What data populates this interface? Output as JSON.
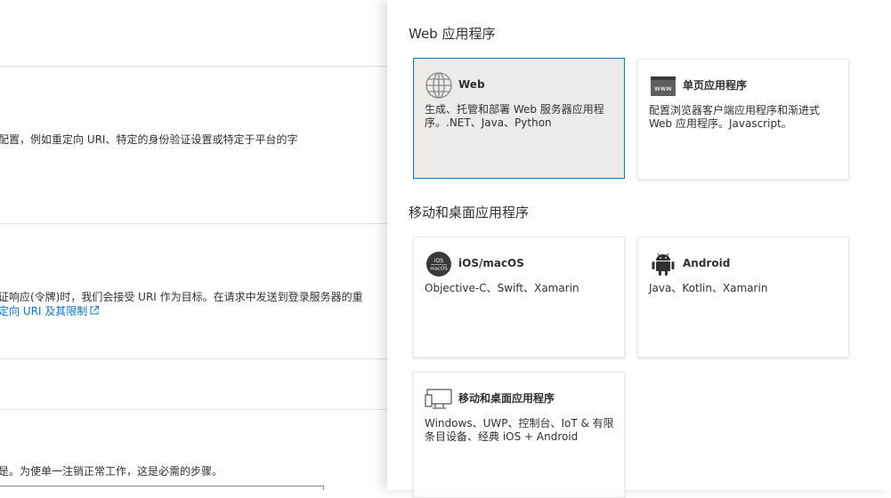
{
  "left": {
    "text_a": "配置，例如重定向 URI、特定的身份验证设置或特定于平台的字",
    "text_b": "证响应(令牌)时，我们会接受 URI 作为目标。在请求中发送到登录服务器的重",
    "link_c": "定向 URI 及其限制",
    "text_d": "是。为使单一注销正常工作，这是必需的步骤。"
  },
  "panel": {
    "sections": [
      {
        "title": "Web 应用程序",
        "cards": [
          {
            "title": "Web",
            "desc": "生成、托管和部署 Web 服务器应用程序。.NET、Java、Python",
            "icon": "globe-icon",
            "selected": true
          },
          {
            "title": "单页应用程序",
            "desc": "配置浏览器客户端应用程序和渐进式 Web 应用程序。Javascript。",
            "icon": "www-browser-icon",
            "selected": false
          }
        ]
      },
      {
        "title": "移动和桌面应用程序",
        "cards": [
          {
            "title": "iOS/macOS",
            "desc": "Objective-C、Swift、Xamarin",
            "icon": "ios-macos-icon",
            "icon_line1": "iOS",
            "icon_line2": "macOS",
            "selected": false
          },
          {
            "title": "Android",
            "desc": "Java、Kotlin、Xamarin",
            "icon": "android-icon",
            "selected": false
          },
          {
            "title": "移动和桌面应用程序",
            "desc": "Windows、UWP、控制台、IoT & 有限条目设备、经典 iOS + Android",
            "icon": "desktop-monitor-icon",
            "selected": false
          }
        ]
      }
    ]
  },
  "colors": {
    "accent": "#0078d4",
    "selected_bg": "#edebe9",
    "text": "#323130"
  }
}
